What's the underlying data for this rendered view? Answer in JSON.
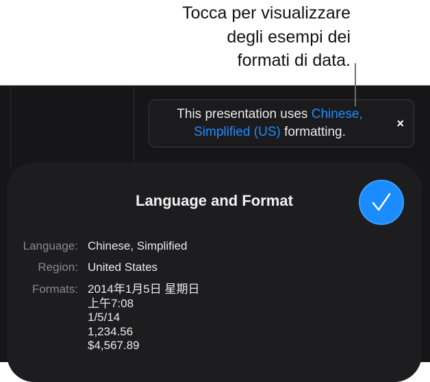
{
  "callout": {
    "lines": [
      "Tocca per visualizzare",
      "degli esempi dei",
      "formati di data."
    ]
  },
  "banner": {
    "prefix": "This presentation uses ",
    "link": "Chinese, Simplified (US)",
    "suffix": " formatting.",
    "close": "×"
  },
  "panel": {
    "title": "Language and Format",
    "language_label": "Language:",
    "language_value": "Chinese, Simplified",
    "region_label": "Region:",
    "region_value": "United States",
    "formats_label": "Formats:",
    "formats": [
      "2014年1月5日 星期日",
      "上午7:08",
      "1/5/14",
      "1,234.56",
      "$4,567.89"
    ]
  },
  "colors": {
    "accent": "#1a8cff",
    "background": "#161618",
    "panel": "#1d1d1f"
  }
}
